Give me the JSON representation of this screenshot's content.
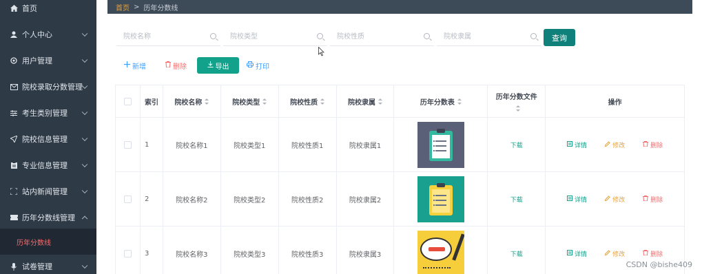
{
  "sidebar": {
    "items": [
      {
        "label": "首页",
        "icon": "home-icon",
        "has_chevron": false
      },
      {
        "label": "个人中心",
        "icon": "user-icon",
        "has_chevron": true
      },
      {
        "label": "用户管理",
        "icon": "gear-icon",
        "has_chevron": true
      },
      {
        "label": "院校录取分数管理",
        "icon": "mail-icon",
        "has_chevron": true
      },
      {
        "label": "考生类别管理",
        "icon": "sliders-icon",
        "has_chevron": true
      },
      {
        "label": "院校信息管理",
        "icon": "send-icon",
        "has_chevron": true
      },
      {
        "label": "专业信息管理",
        "icon": "clipboard-icon",
        "has_chevron": true
      },
      {
        "label": "站内新闻管理",
        "icon": "fullscreen-icon",
        "has_chevron": true
      },
      {
        "label": "历年分数线管理",
        "icon": "ticket-icon",
        "has_chevron": true,
        "expanded": true
      },
      {
        "label": "试卷管理",
        "icon": "microphone-icon",
        "has_chevron": true
      }
    ],
    "active_sub_item": "历年分数线"
  },
  "breadcrumb": {
    "home": "首页",
    "separator": ">",
    "current": "历年分数线"
  },
  "search": {
    "school_name_placeholder": "院校名称",
    "school_type_placeholder": "院校类型",
    "school_nature_placeholder": "院校性质",
    "school_affiliation_placeholder": "院校隶属",
    "query_label": "查询"
  },
  "toolbar": {
    "add_label": "新增",
    "delete_label": "删除",
    "export_label": "导出",
    "print_label": "打印"
  },
  "table": {
    "headers": {
      "index": "索引",
      "school_name": "院校名称",
      "school_type": "院校类型",
      "school_nature": "院校性质",
      "school_affiliation": "院校隶属",
      "score_table": "历年分数表",
      "score_file": "历年分数文件",
      "actions": "操作"
    },
    "rows": [
      {
        "index": "1",
        "school_name": "院校名称1",
        "school_type": "院校类型1",
        "school_nature": "院校性质1",
        "school_affiliation": "院校隶属1",
        "file_link": "下载",
        "detail": "详情",
        "edit": "修改",
        "delete": "删除"
      },
      {
        "index": "2",
        "school_name": "院校名称2",
        "school_type": "院校类型2",
        "school_nature": "院校性质2",
        "school_affiliation": "院校隶属2",
        "file_link": "下载",
        "detail": "详情",
        "edit": "修改",
        "delete": "删除"
      },
      {
        "index": "3",
        "school_name": "院校名称3",
        "school_type": "院校类型3",
        "school_nature": "院校性质3",
        "school_affiliation": "院校隶属3",
        "file_link": "下载",
        "detail": "详情",
        "edit": "修改",
        "delete": "删除"
      }
    ]
  },
  "watermark": "CSDN @bishe409",
  "colors": {
    "sidebar_bg": "#2f3a47",
    "primary": "#12a18a",
    "danger": "#f56c6c",
    "warning": "#e6a23c",
    "link": "#409eff"
  }
}
